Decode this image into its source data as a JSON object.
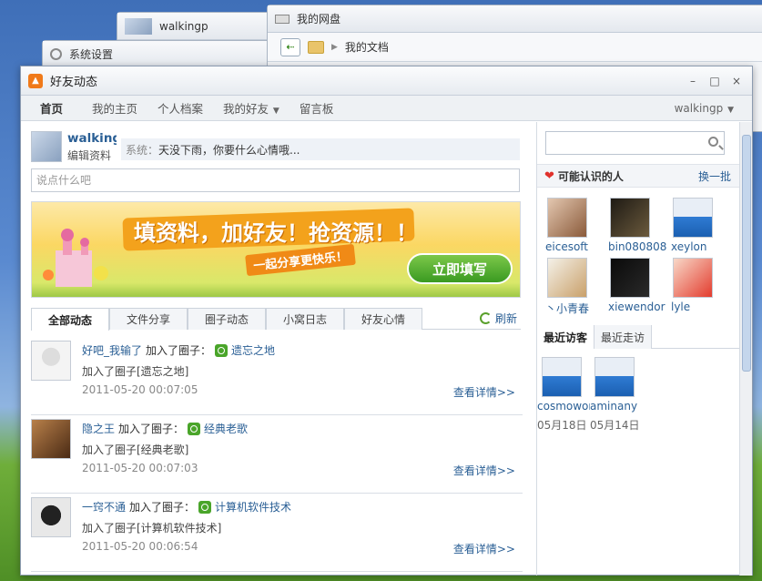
{
  "background_windows": {
    "back": {
      "title": "walkingp"
    },
    "settings": {
      "title": "系统设置"
    },
    "disk": {
      "title": "我的网盘",
      "path": "我的文档"
    }
  },
  "window": {
    "title": "好友动态",
    "controls": [
      "–",
      "□",
      "×"
    ]
  },
  "nav": {
    "items": [
      "首页",
      "我的主页",
      "个人档案",
      "我的好友",
      "留言板"
    ],
    "user": "walkingp"
  },
  "profile": {
    "name": "walkingp",
    "edit_label": "编辑资料",
    "status_label": "系统：",
    "status_text": "天没下雨，你要什么心情哦..."
  },
  "composer": {
    "placeholder": "说点什么吧"
  },
  "banner": {
    "headline": "填资料，加好友！抢资源！！",
    "subline": "一起分享更快乐！",
    "cta": "立即填写"
  },
  "tabs": [
    "全部动态",
    "文件分享",
    "圈子动态",
    "小窝日志",
    "好友心情"
  ],
  "refresh_label": "刷新",
  "feed": [
    {
      "user": "好吧_我输了",
      "action": "加入了圈子：",
      "group": "遗忘之地",
      "detail": "加入了圈子[遗忘之地]",
      "time": "2011-05-20 00:07:05",
      "more": "查看详情>>"
    },
    {
      "user": "隐之王",
      "action": "加入了圈子：",
      "group": "经典老歌",
      "detail": "加入了圈子[经典老歌]",
      "time": "2011-05-20 00:07:03",
      "more": "查看详情>>"
    },
    {
      "user": "一窍不通",
      "action": "加入了圈子：",
      "group": "计算机软件技术",
      "detail": "加入了圈子[计算机软件技术]",
      "time": "2011-05-20 00:06:54",
      "more": "查看详情>>"
    }
  ],
  "sidebar": {
    "may_know": {
      "title": "可能认识的人",
      "more": "换一批"
    },
    "people": [
      "eicesoft",
      "bin080808",
      "xeylon",
      "丶小青春",
      "xiewendor",
      "lyle"
    ],
    "visitor_tabs": [
      "最近访客",
      "最近走访"
    ],
    "visitors": [
      {
        "name": "cosmowor",
        "date": "05月18日"
      },
      {
        "name": "aminany",
        "date": "05月14日"
      }
    ]
  }
}
